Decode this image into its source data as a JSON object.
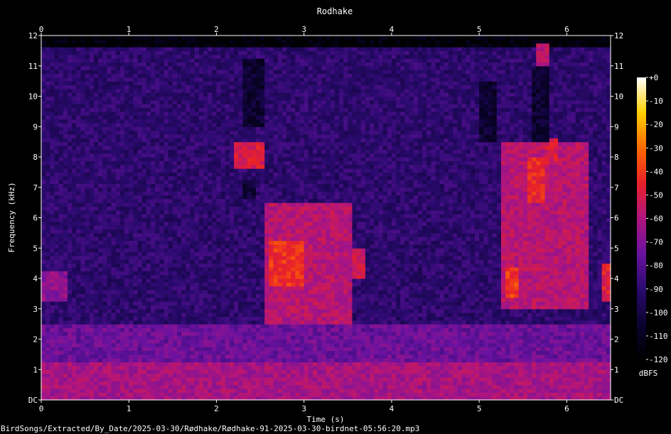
{
  "chart_data": {
    "type": "heatmap",
    "title": "Rodhake",
    "xlabel": "Time (s)",
    "ylabel": "Frequency (kHz)",
    "xlim": [
      0,
      6.5
    ],
    "ylim": [
      0,
      12
    ],
    "x_ticks": [
      {
        "value": 0,
        "label": "0"
      },
      {
        "value": 1,
        "label": "1"
      },
      {
        "value": 2,
        "label": "2"
      },
      {
        "value": 3,
        "label": "3"
      },
      {
        "value": 4,
        "label": "4"
      },
      {
        "value": 5,
        "label": "5"
      },
      {
        "value": 6,
        "label": "6"
      }
    ],
    "y_ticks": [
      {
        "value": 0,
        "label": "DC"
      },
      {
        "value": 1,
        "label": "1"
      },
      {
        "value": 2,
        "label": "2"
      },
      {
        "value": 3,
        "label": "3"
      },
      {
        "value": 4,
        "label": "4"
      },
      {
        "value": 5,
        "label": "5"
      },
      {
        "value": 6,
        "label": "6"
      },
      {
        "value": 7,
        "label": "7"
      },
      {
        "value": 8,
        "label": "8"
      },
      {
        "value": 9,
        "label": "9"
      },
      {
        "value": 10,
        "label": "10"
      },
      {
        "value": 11,
        "label": "11"
      },
      {
        "value": 12,
        "label": "12"
      }
    ],
    "colorbar": {
      "label": "dBFS",
      "range": [
        -120,
        0
      ],
      "ticks": [
        {
          "value": 0,
          "label": "+0"
        },
        {
          "value": -10,
          "label": "-10"
        },
        {
          "value": -20,
          "label": "-20"
        },
        {
          "value": -30,
          "label": "-30"
        },
        {
          "value": -40,
          "label": "-40"
        },
        {
          "value": -50,
          "label": "-50"
        },
        {
          "value": -60,
          "label": "-60"
        },
        {
          "value": -70,
          "label": "-70"
        },
        {
          "value": -80,
          "label": "-80"
        },
        {
          "value": -90,
          "label": "-90"
        },
        {
          "value": -100,
          "label": "-100"
        },
        {
          "value": -110,
          "label": "-110"
        },
        {
          "value": -120,
          "label": "-120"
        }
      ],
      "colors": [
        "#000000",
        "#0b0330",
        "#2a0a6e",
        "#6a12a0",
        "#b0157e",
        "#e8202a",
        "#ff6a00",
        "#ffd000",
        "#ffffff"
      ]
    },
    "background_level_db": -90,
    "regions": [
      {
        "t": [
          0,
          6.5
        ],
        "f": [
          0,
          1.2
        ],
        "db": -62
      },
      {
        "t": [
          0,
          6.5
        ],
        "f": [
          1.2,
          2.5
        ],
        "db": -75
      },
      {
        "t": [
          0,
          0.3
        ],
        "f": [
          3.2,
          4.3
        ],
        "db": -68
      },
      {
        "t": [
          2.55,
          3.55
        ],
        "f": [
          2.5,
          6.5
        ],
        "db": -58
      },
      {
        "t": [
          2.6,
          3.0
        ],
        "f": [
          3.7,
          5.2
        ],
        "db": -42
      },
      {
        "t": [
          2.2,
          2.55
        ],
        "f": [
          7.6,
          8.5
        ],
        "db": -50
      },
      {
        "t": [
          3.55,
          3.7
        ],
        "f": [
          4.0,
          5.0
        ],
        "db": -52
      },
      {
        "t": [
          5.25,
          6.25
        ],
        "f": [
          3.0,
          8.5
        ],
        "db": -58
      },
      {
        "t": [
          5.3,
          5.45
        ],
        "f": [
          3.4,
          4.4
        ],
        "db": -40
      },
      {
        "t": [
          5.55,
          5.75
        ],
        "f": [
          6.5,
          8.0
        ],
        "db": -45
      },
      {
        "t": [
          5.75,
          5.9
        ],
        "f": [
          7.8,
          8.6
        ],
        "db": -50
      },
      {
        "t": [
          6.4,
          6.5
        ],
        "f": [
          3.3,
          4.5
        ],
        "db": -48
      },
      {
        "t": [
          5.65,
          5.8
        ],
        "f": [
          10.5,
          11.7
        ],
        "db": -58
      }
    ],
    "quiet_regions": [
      {
        "t": [
          2.3,
          2.55
        ],
        "f": [
          9.0,
          11.3
        ]
      },
      {
        "t": [
          2.3,
          2.45
        ],
        "f": [
          6.6,
          7.3
        ]
      },
      {
        "t": [
          5.0,
          5.2
        ],
        "f": [
          8.5,
          10.5
        ]
      },
      {
        "t": [
          5.6,
          5.8
        ],
        "f": [
          8.5,
          11.0
        ]
      }
    ]
  },
  "footer": {
    "path": "BirdSongs/Extracted/By_Date/2025-03-30/Rødhake/Rødhake-91-2025-03-30-birdnet-05:56:20.mp3"
  }
}
